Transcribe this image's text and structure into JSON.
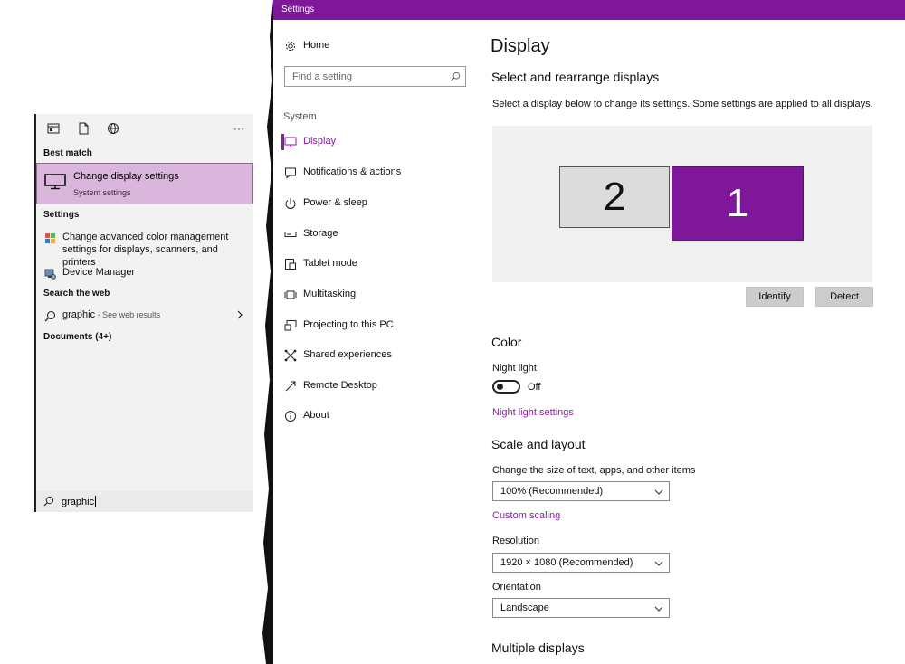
{
  "search": {
    "toolbar_more": "···",
    "best_match_header": "Best match",
    "best_match": {
      "title": "Change display settings",
      "subtitle": "System settings"
    },
    "settings_header": "Settings",
    "settings_items": [
      {
        "line1": "Change advanced color management",
        "line2": "settings for displays, scanners, and printers"
      },
      {
        "line1": "Device Manager"
      }
    ],
    "web_header": "Search the web",
    "web_item": {
      "query": "graphic",
      "suffix": " - See web results"
    },
    "documents_header": "Documents (4+)",
    "query": "graphic"
  },
  "settings": {
    "window_title": "Settings",
    "nav": {
      "home": "Home",
      "find_placeholder": "Find a setting",
      "group": "System",
      "items": [
        {
          "label": "Display",
          "icon": "monitor-icon",
          "active": true
        },
        {
          "label": "Notifications & actions",
          "icon": "notification-icon"
        },
        {
          "label": "Power & sleep",
          "icon": "power-icon"
        },
        {
          "label": "Storage",
          "icon": "storage-icon"
        },
        {
          "label": "Tablet mode",
          "icon": "tablet-icon"
        },
        {
          "label": "Multitasking",
          "icon": "multitasking-icon"
        },
        {
          "label": "Projecting to this PC",
          "icon": "projecting-icon"
        },
        {
          "label": "Shared experiences",
          "icon": "shared-experiences-icon"
        },
        {
          "label": "Remote Desktop",
          "icon": "remote-desktop-icon"
        },
        {
          "label": "About",
          "icon": "info-icon"
        }
      ]
    },
    "content": {
      "page_title": "Display",
      "arrange_title": "Select and rearrange displays",
      "arrange_desc": "Select a display below to change its settings. Some settings are applied to all displays.",
      "monitors": [
        "2",
        "1"
      ],
      "identify_label": "Identify",
      "detect_label": "Detect",
      "color_title": "Color",
      "night_light_label": "Night light",
      "night_light_state": "Off",
      "night_light_link": "Night light settings",
      "scale_title": "Scale and layout",
      "scale_label": "Change the size of text, apps, and other items",
      "scale_value": "100% (Recommended)",
      "custom_scaling_link": "Custom scaling",
      "resolution_label": "Resolution",
      "resolution_value": "1920 × 1080 (Recommended)",
      "orientation_label": "Orientation",
      "orientation_value": "Landscape",
      "multiple_title": "Multiple displays"
    },
    "accent_color": "#7e179a"
  }
}
